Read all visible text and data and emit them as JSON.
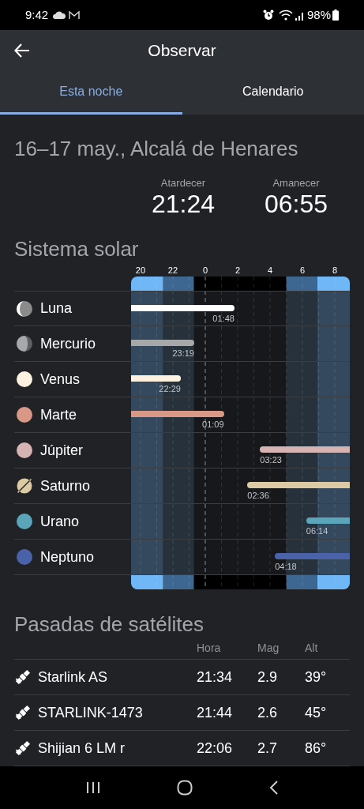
{
  "status_bar": {
    "time": "9:42",
    "battery": "98%"
  },
  "header": {
    "title": "Observar"
  },
  "tabs": [
    {
      "label": "Esta noche",
      "selected": true
    },
    {
      "label": "Calendario",
      "selected": false
    }
  ],
  "tonight": {
    "title": "16–17 may., Alcalá de Henares",
    "sunset": {
      "label": "Atardecer",
      "time": "21:24"
    },
    "sunrise": {
      "label": "Amanecer",
      "time": "06:55"
    }
  },
  "solar_system": {
    "title": "Sistema solar",
    "hour_ticks": [
      "20",
      "22",
      "0",
      "2",
      "4",
      "6",
      "8"
    ],
    "planets": [
      {
        "name": "Luna",
        "color": "#ffffff",
        "kind": "sets",
        "time": "01:48"
      },
      {
        "name": "Mercurio",
        "color": "#a7a8aa",
        "kind": "sets",
        "time": "23:19"
      },
      {
        "name": "Venus",
        "color": "#fdf2e2",
        "kind": "sets",
        "time": "22:29"
      },
      {
        "name": "Marte",
        "color": "#d99886",
        "kind": "sets",
        "time": "01:09"
      },
      {
        "name": "Júpiter",
        "color": "#d7b4b4",
        "kind": "rises",
        "time": "03:23"
      },
      {
        "name": "Saturno",
        "color": "#dccaa4",
        "kind": "rises",
        "time": "02:36"
      },
      {
        "name": "Urano",
        "color": "#5aa5ba",
        "kind": "rises",
        "time": "06:14"
      },
      {
        "name": "Neptuno",
        "color": "#4a62a8",
        "kind": "rises",
        "time": "04:18"
      }
    ]
  },
  "satellite_passes": {
    "title": "Pasadas de satélites",
    "columns": [
      "Hora",
      "Mag",
      "Alt"
    ],
    "rows": [
      {
        "name": "Starlink AS",
        "time": "21:34",
        "mag": "2.9",
        "alt": "39°"
      },
      {
        "name": "STARLINK-1473",
        "time": "21:44",
        "mag": "2.6",
        "alt": "45°"
      },
      {
        "name": "Shijian 6 LM r",
        "time": "22:06",
        "mag": "2.7",
        "alt": "86°"
      }
    ]
  }
}
